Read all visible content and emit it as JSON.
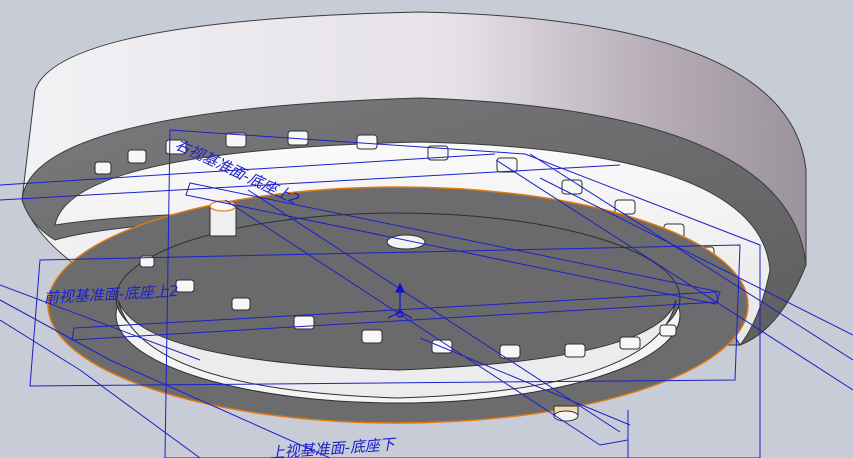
{
  "viewport": {
    "name": "3d-model-viewport",
    "background": "#c8ccd6"
  },
  "planes": {
    "right_plane_label": "右视基准面-底座上2",
    "front_plane_label": "前视基准面-底座上2",
    "top_plane_label": "上视基准面-底座下"
  },
  "colors": {
    "plane_line": "#1c20c8",
    "edge_highlight": "#e07a10",
    "part_face_light": "#f4f4f6",
    "part_face_dark": "#9a9098",
    "recess_dark": "#6b6b6d",
    "axis_blue": "#1010d0"
  },
  "model": {
    "part_name": "base-ring-assembly",
    "peg_count_outer": 20,
    "peg_count_inner": 20
  }
}
